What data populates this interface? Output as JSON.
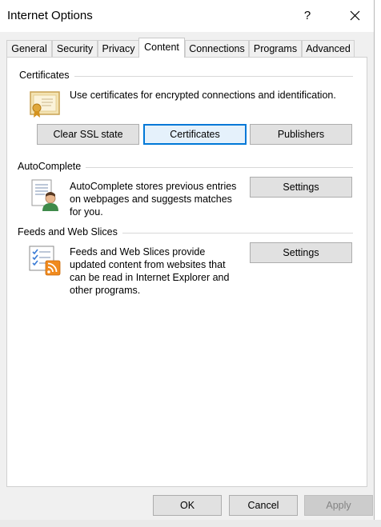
{
  "window": {
    "title": "Internet Options",
    "help_label": "?"
  },
  "tabs": [
    {
      "label": "General"
    },
    {
      "label": "Security"
    },
    {
      "label": "Privacy"
    },
    {
      "label": "Content"
    },
    {
      "label": "Connections"
    },
    {
      "label": "Programs"
    },
    {
      "label": "Advanced"
    }
  ],
  "certificates": {
    "heading": "Certificates",
    "description": "Use certificates for encrypted connections and identification.",
    "clear_ssl_label": "Clear SSL state",
    "certificates_label": "Certificates",
    "publishers_label": "Publishers",
    "icon": "certificate-icon"
  },
  "autocomplete": {
    "heading": "AutoComplete",
    "line1": "AutoComplete stores previous entries",
    "line2": "on webpages and suggests matches",
    "line3": "for you.",
    "settings_label": "Settings",
    "icon": "autocomplete-icon"
  },
  "feeds": {
    "heading": "Feeds and Web Slices",
    "line1": "Feeds and Web Slices provide",
    "line2": "updated content from websites that",
    "line3": "can be read in Internet Explorer and",
    "line4": "other programs.",
    "settings_label": "Settings",
    "icon": "feeds-icon"
  },
  "footer": {
    "ok_label": "OK",
    "cancel_label": "Cancel",
    "apply_label": "Apply"
  },
  "colors": {
    "accent": "#0078d7",
    "dialog_bg": "#f0f0f0",
    "panel_bg": "#ffffff"
  }
}
